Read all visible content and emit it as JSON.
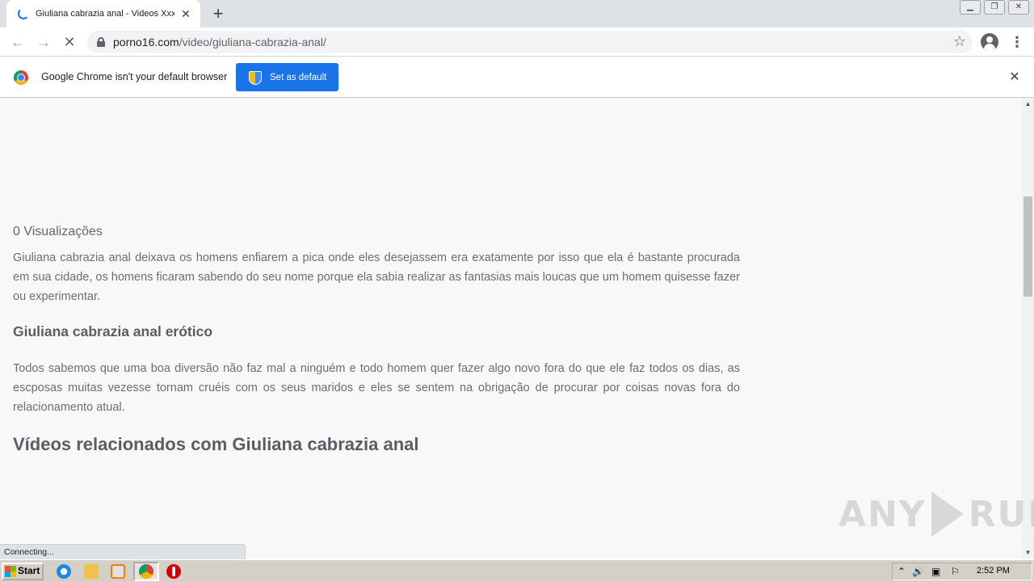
{
  "browser": {
    "tab_title": "Giuliana cabrazia anal - Videos Xxx |",
    "new_tab_symbol": "+",
    "url_domain": "porno16.com",
    "url_path": "/video/giuliana-cabrazia-anal/",
    "status_text": "Connecting..."
  },
  "infobar": {
    "message": "Google Chrome isn't your default browser",
    "button_label": "Set as default"
  },
  "page": {
    "views": "0 Visualizações",
    "paragraph1": "Giuliana cabrazia anal deixava os homens enfiarem a pica onde eles desejassem era exatamente por isso que ela é bastante procurada em sua cidade, os homens ficaram sabendo do seu nome porque ela sabia realizar as fantasias mais loucas que um homem quisesse fazer ou experimentar.",
    "heading": "Giuliana cabrazia anal erótico",
    "paragraph2": "Todos sabemos que uma boa diversão não faz mal a ninguém e todo homem quer fazer algo novo fora do que ele faz todos os dias, as escposas muitas vezesse tornam cruéis com os seus maridos e eles se sentem na obrigação de procurar por coisas novas fora do relacionamento atual.",
    "related_heading": "Vídeos relacionados com Giuliana cabrazia anal"
  },
  "watermark": {
    "left": "ANY",
    "right": "RUN"
  },
  "taskbar": {
    "start_label": "Start",
    "clock": "2:52 PM"
  },
  "colors": {
    "accent": "#1a73e8",
    "page_bg": "#f8f8f9",
    "text": "#6a6e73"
  }
}
